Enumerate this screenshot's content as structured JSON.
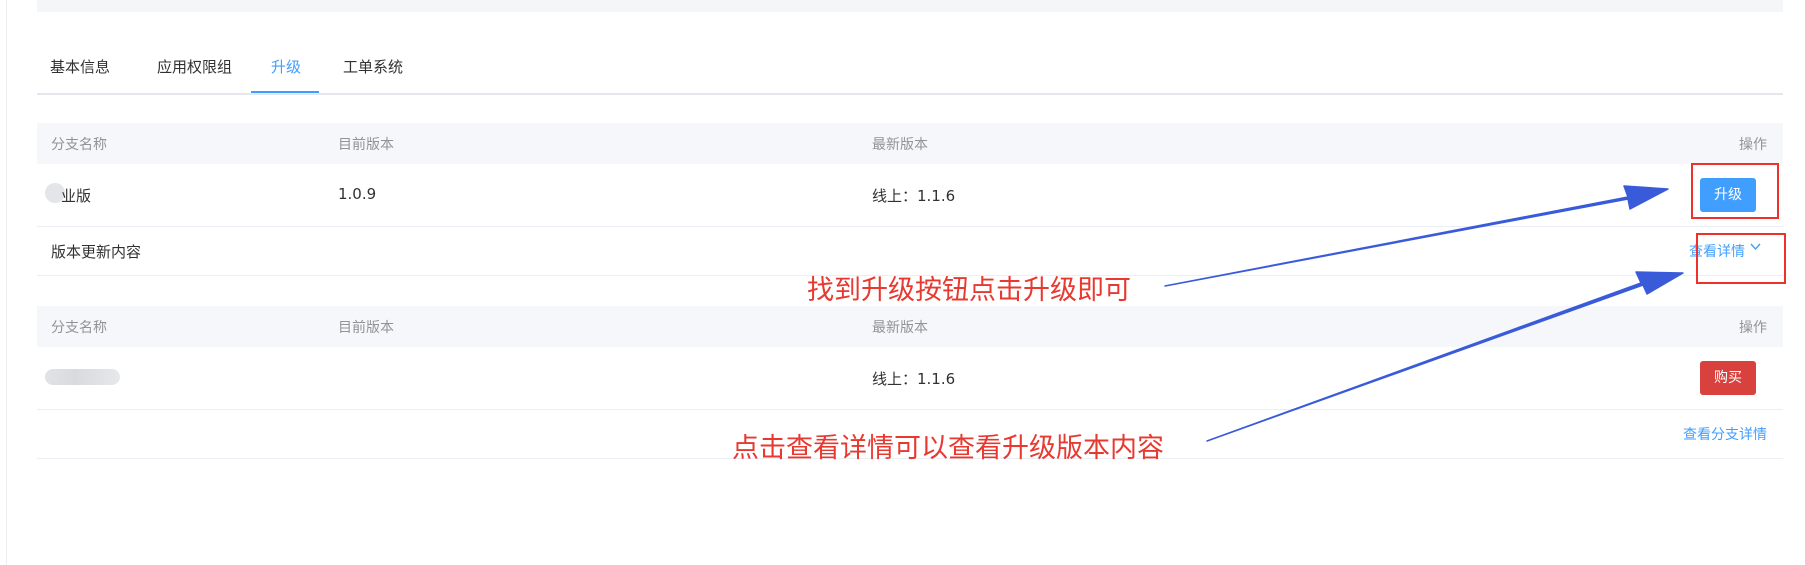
{
  "tabs": {
    "items": [
      {
        "label": "基本信息"
      },
      {
        "label": "应用权限组"
      },
      {
        "label": "升级"
      },
      {
        "label": "工单系统"
      }
    ],
    "active_index": 2
  },
  "table_header": {
    "col1": "分支名称",
    "col2": "目前版本",
    "col3": "最新版本",
    "col4": "操作"
  },
  "branch1": {
    "name": "业版",
    "current_version": "1.0.9",
    "latest_version": "线上：1.1.6",
    "action_label": "升级",
    "details_label": "版本更新内容",
    "view_details_label": "查看详情"
  },
  "branch2": {
    "latest_version": "线上：1.1.6",
    "action_label": "购买",
    "view_details_label": "查看分支详情"
  },
  "annotations": {
    "upgrade_hint": "找到升级按钮点击升级即可",
    "details_hint": "点击查看详情可以查看升级版本内容"
  },
  "colors": {
    "accent": "#409eff",
    "danger": "#d9413f",
    "annotation": "#e83931",
    "arrow": "#3a5bd9"
  }
}
